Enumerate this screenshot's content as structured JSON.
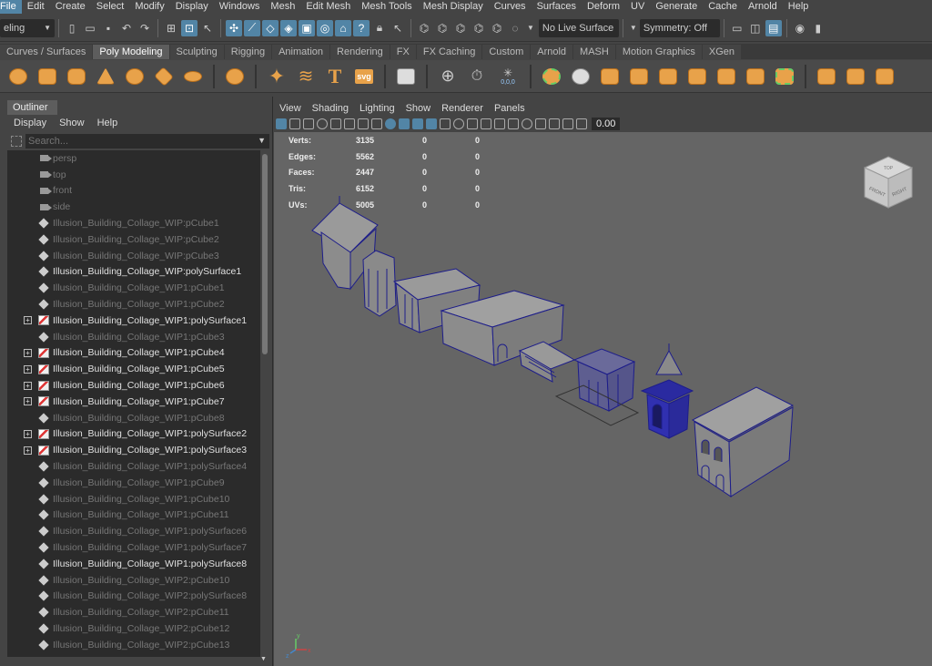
{
  "menubar": [
    "File",
    "Edit",
    "Create",
    "Select",
    "Modify",
    "Display",
    "Windows",
    "Mesh",
    "Edit Mesh",
    "Mesh Tools",
    "Mesh Display",
    "Curves",
    "Surfaces",
    "Deform",
    "UV",
    "Generate",
    "Cache",
    "Arnold",
    "Help"
  ],
  "status": {
    "mode": "eling",
    "live_surface": "No Live Surface",
    "symmetry": "Symmetry: Off"
  },
  "shelf_tabs": [
    "Curves / Surfaces",
    "Poly Modeling",
    "Sculpting",
    "Rigging",
    "Animation",
    "Rendering",
    "FX",
    "FX Caching",
    "Custom",
    "Arnold",
    "MASH",
    "Motion Graphics",
    "XGen"
  ],
  "shelf_active": "Poly Modeling",
  "shelf_labels": {
    "text_tool": "T",
    "svg_tool": "svg",
    "origin_readout": "0,0,0"
  },
  "outliner": {
    "tab": "Outliner",
    "menu": [
      "Display",
      "Show",
      "Help"
    ],
    "search_placeholder": "Search...",
    "items": [
      {
        "label": "persp",
        "icon": "camera",
        "state": "dim",
        "exp": false
      },
      {
        "label": "top",
        "icon": "camera",
        "state": "dim",
        "exp": false
      },
      {
        "label": "front",
        "icon": "camera",
        "state": "dim",
        "exp": false
      },
      {
        "label": "side",
        "icon": "camera",
        "state": "dim",
        "exp": false
      },
      {
        "label": "Illusion_Building_Collage_WIP:pCube1",
        "icon": "mesh",
        "state": "dim",
        "exp": false
      },
      {
        "label": "Illusion_Building_Collage_WIP:pCube2",
        "icon": "mesh",
        "state": "dim",
        "exp": false
      },
      {
        "label": "Illusion_Building_Collage_WIP:pCube3",
        "icon": "mesh",
        "state": "dim",
        "exp": false
      },
      {
        "label": "Illusion_Building_Collage_WIP:polySurface1",
        "icon": "mesh",
        "state": "br",
        "exp": false
      },
      {
        "label": "Illusion_Building_Collage_WIP1:pCube1",
        "icon": "mesh",
        "state": "dim",
        "exp": false
      },
      {
        "label": "Illusion_Building_Collage_WIP1:pCube2",
        "icon": "mesh",
        "state": "dim",
        "exp": false
      },
      {
        "label": "Illusion_Building_Collage_WIP1:polySurface1",
        "icon": "poly",
        "state": "br",
        "exp": true
      },
      {
        "label": "Illusion_Building_Collage_WIP1:pCube3",
        "icon": "mesh",
        "state": "dim",
        "exp": false
      },
      {
        "label": "Illusion_Building_Collage_WIP1:pCube4",
        "icon": "poly",
        "state": "br",
        "exp": true
      },
      {
        "label": "Illusion_Building_Collage_WIP1:pCube5",
        "icon": "poly",
        "state": "br",
        "exp": true
      },
      {
        "label": "Illusion_Building_Collage_WIP1:pCube6",
        "icon": "poly",
        "state": "br",
        "exp": true
      },
      {
        "label": "Illusion_Building_Collage_WIP1:pCube7",
        "icon": "poly",
        "state": "br",
        "exp": true
      },
      {
        "label": "Illusion_Building_Collage_WIP1:pCube8",
        "icon": "mesh",
        "state": "dim",
        "exp": false
      },
      {
        "label": "Illusion_Building_Collage_WIP1:polySurface2",
        "icon": "poly",
        "state": "br",
        "exp": true
      },
      {
        "label": "Illusion_Building_Collage_WIP1:polySurface3",
        "icon": "poly",
        "state": "br",
        "exp": true
      },
      {
        "label": "Illusion_Building_Collage_WIP1:polySurface4",
        "icon": "mesh",
        "state": "dim",
        "exp": false
      },
      {
        "label": "Illusion_Building_Collage_WIP1:pCube9",
        "icon": "mesh",
        "state": "dim",
        "exp": false
      },
      {
        "label": "Illusion_Building_Collage_WIP1:pCube10",
        "icon": "mesh",
        "state": "dim",
        "exp": false
      },
      {
        "label": "Illusion_Building_Collage_WIP1:pCube11",
        "icon": "mesh",
        "state": "dim",
        "exp": false
      },
      {
        "label": "Illusion_Building_Collage_WIP1:polySurface6",
        "icon": "mesh",
        "state": "dim",
        "exp": false
      },
      {
        "label": "Illusion_Building_Collage_WIP1:polySurface7",
        "icon": "mesh",
        "state": "dim",
        "exp": false
      },
      {
        "label": "Illusion_Building_Collage_WIP1:polySurface8",
        "icon": "mesh",
        "state": "br",
        "exp": false
      },
      {
        "label": "Illusion_Building_Collage_WIP2:pCube10",
        "icon": "mesh",
        "state": "dim",
        "exp": false
      },
      {
        "label": "Illusion_Building_Collage_WIP2:polySurface8",
        "icon": "mesh",
        "state": "dim",
        "exp": false
      },
      {
        "label": "Illusion_Building_Collage_WIP2:pCube11",
        "icon": "mesh",
        "state": "dim",
        "exp": false
      },
      {
        "label": "Illusion_Building_Collage_WIP2:pCube12",
        "icon": "mesh",
        "state": "dim",
        "exp": false
      },
      {
        "label": "Illusion_Building_Collage_WIP2:pCube13",
        "icon": "mesh",
        "state": "dim",
        "exp": false
      }
    ]
  },
  "viewport": {
    "menu": [
      "View",
      "Shading",
      "Lighting",
      "Show",
      "Renderer",
      "Panels"
    ],
    "toolbar_value": "0.00",
    "hud": [
      {
        "k": "Verts:",
        "a": "3135",
        "b": "0",
        "c": "0"
      },
      {
        "k": "Edges:",
        "a": "5562",
        "b": "0",
        "c": "0"
      },
      {
        "k": "Faces:",
        "a": "2447",
        "b": "0",
        "c": "0"
      },
      {
        "k": "Tris:",
        "a": "6152",
        "b": "0",
        "c": "0"
      },
      {
        "k": "UVs:",
        "a": "5005",
        "b": "0",
        "c": "0"
      }
    ],
    "view_cube": {
      "front": "FRONT",
      "right": "RIGHT",
      "top": "TOP"
    },
    "axis": {
      "y": "y",
      "x": "x",
      "z": "z"
    }
  }
}
